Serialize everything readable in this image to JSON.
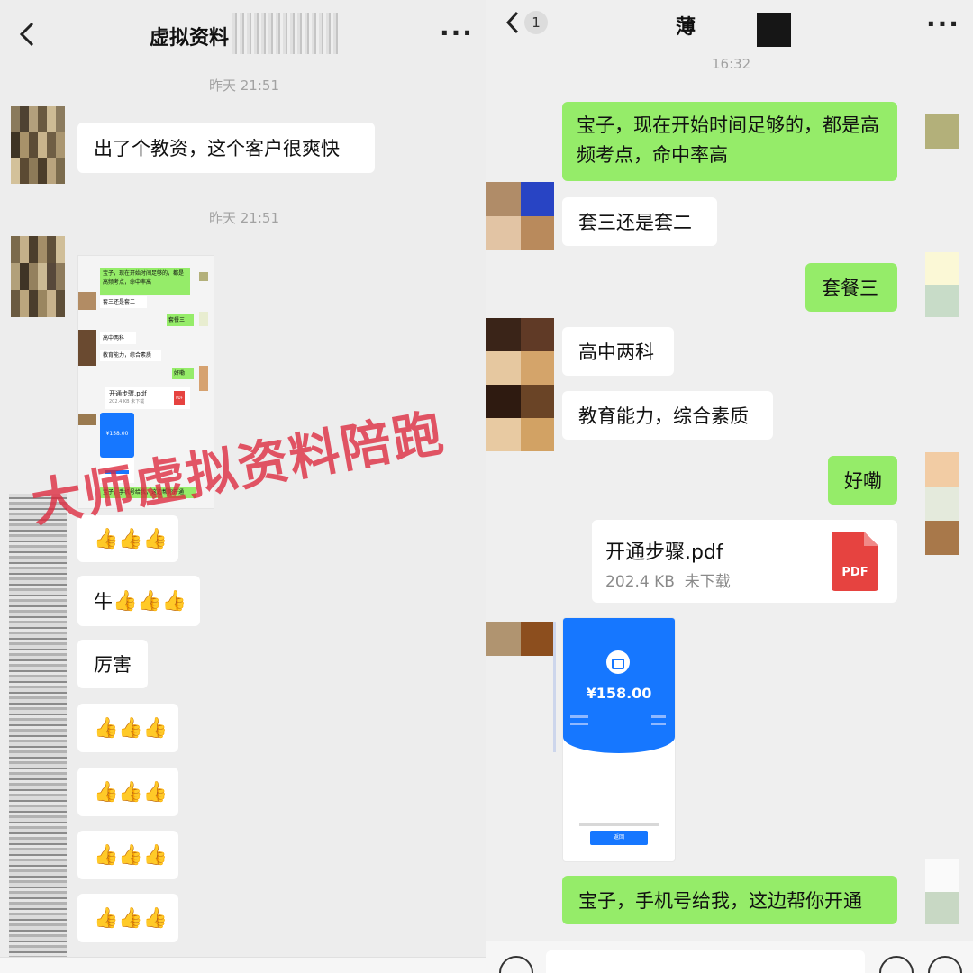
{
  "left": {
    "header": {
      "back_icon": "chevron-left-icon",
      "title": "虚拟资料",
      "more": "···"
    },
    "timestamps": [
      "昨天 21:51",
      "昨天 21:51"
    ],
    "first_message": "出了个教资，这个客户很爽快",
    "embedded_screenshot": {
      "m1": "宝子，现在开始时间足够的，都是高频考点，命中率高",
      "m2": "套三还是套二",
      "m3": "套餐三",
      "m4": "高中两科",
      "m5": "教育能力，综合素质",
      "m6": "好嘞",
      "file_name": "开通步骤.pdf",
      "file_meta": "202.4 KB  未下载",
      "pdf": "PDF",
      "amount": "¥158.00",
      "bottom": "宝子，手机号给我，这边帮你开通"
    },
    "watermark": "大师虚拟资料陪跑",
    "messages": [
      {
        "prefix": "",
        "emoji": "👍👍👍"
      },
      {
        "prefix": "牛",
        "emoji": "👍👍👍"
      },
      {
        "prefix": "厉害",
        "emoji": ""
      },
      {
        "prefix": "",
        "emoji": "👍👍👍"
      },
      {
        "prefix": "",
        "emoji": "👍👍👍"
      },
      {
        "prefix": "",
        "emoji": "👍👍👍"
      },
      {
        "prefix": "",
        "emoji": "👍👍👍"
      }
    ]
  },
  "right": {
    "header": {
      "back_icon": "chevron-left-icon",
      "unread_badge": "1",
      "title": "薄",
      "more": "···"
    },
    "timestamp": "16:32",
    "messages": [
      {
        "side": "out",
        "text": "宝子，现在开始时间足够的，都是高频考点，命中率高"
      },
      {
        "side": "in",
        "text": "套三还是套二"
      },
      {
        "side": "out",
        "text": "套餐三"
      },
      {
        "side": "in",
        "text": "高中两科"
      },
      {
        "side": "in",
        "text": "教育能力，综合素质"
      },
      {
        "side": "out",
        "text": "好嘞"
      },
      {
        "side": "out",
        "text": "宝子，手机号给我，这边帮你开通"
      }
    ],
    "file": {
      "name": "开通步骤.pdf",
      "size": "202.4 KB",
      "status": "未下载",
      "badge": "PDF"
    },
    "payment": {
      "amount": "¥158.00",
      "button": "返回"
    },
    "colors": {
      "green_bubble": "#95ec69",
      "pdf_red": "#e64340",
      "pay_blue": "#1677ff"
    }
  }
}
